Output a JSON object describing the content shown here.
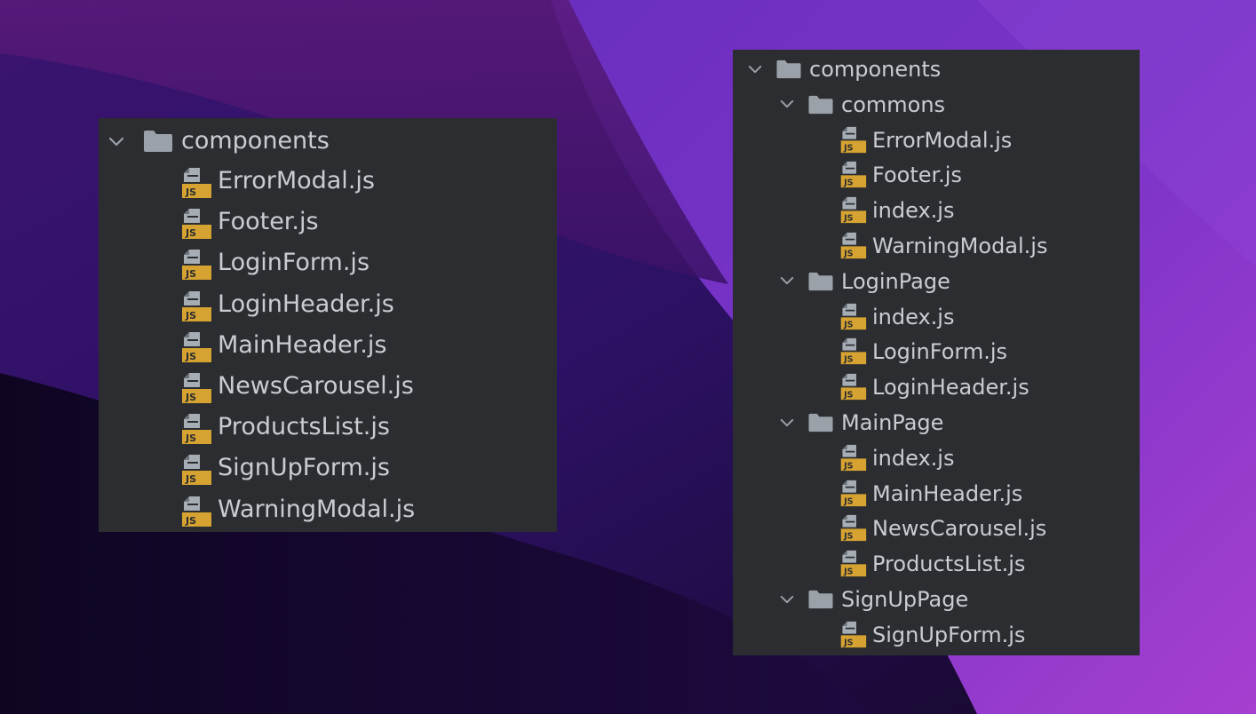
{
  "colors": {
    "panel_bg": "#2b2d30",
    "text": "#c9cdd3",
    "folder_icon": "#9ba1a9",
    "js_badge": "#d6a332"
  },
  "panel_flat": {
    "root": {
      "label": "components",
      "expanded": true
    },
    "files": [
      {
        "label": "ErrorModal.js",
        "icon": "js-file-icon"
      },
      {
        "label": "Footer.js",
        "icon": "js-file-icon"
      },
      {
        "label": "LoginForm.js",
        "icon": "js-file-icon"
      },
      {
        "label": "LoginHeader.js",
        "icon": "js-file-icon"
      },
      {
        "label": "MainHeader.js",
        "icon": "js-file-icon"
      },
      {
        "label": "NewsCarousel.js",
        "icon": "js-file-icon"
      },
      {
        "label": "ProductsList.js",
        "icon": "js-file-icon"
      },
      {
        "label": "SignUpForm.js",
        "icon": "js-file-icon"
      },
      {
        "label": "WarningModal.js",
        "icon": "js-file-icon"
      }
    ]
  },
  "panel_nested": {
    "root": {
      "label": "components",
      "expanded": true
    },
    "folders": [
      {
        "label": "commons",
        "expanded": true,
        "files": [
          {
            "label": "ErrorModal.js",
            "icon": "js-file-icon"
          },
          {
            "label": "Footer.js",
            "icon": "js-file-icon"
          },
          {
            "label": "index.js",
            "icon": "js-file-icon"
          },
          {
            "label": "WarningModal.js",
            "icon": "js-file-icon"
          }
        ]
      },
      {
        "label": "LoginPage",
        "expanded": true,
        "files": [
          {
            "label": "index.js",
            "icon": "js-file-icon"
          },
          {
            "label": "LoginForm.js",
            "icon": "js-file-icon"
          },
          {
            "label": "LoginHeader.js",
            "icon": "js-file-icon"
          }
        ]
      },
      {
        "label": "MainPage",
        "expanded": true,
        "files": [
          {
            "label": "index.js",
            "icon": "js-file-icon"
          },
          {
            "label": "MainHeader.js",
            "icon": "js-file-icon"
          },
          {
            "label": "NewsCarousel.js",
            "icon": "js-file-icon"
          },
          {
            "label": "ProductsList.js",
            "icon": "js-file-icon"
          }
        ]
      },
      {
        "label": "SignUpPage",
        "expanded": true,
        "files": [
          {
            "label": "SignUpForm.js",
            "icon": "js-file-icon"
          }
        ]
      }
    ]
  }
}
